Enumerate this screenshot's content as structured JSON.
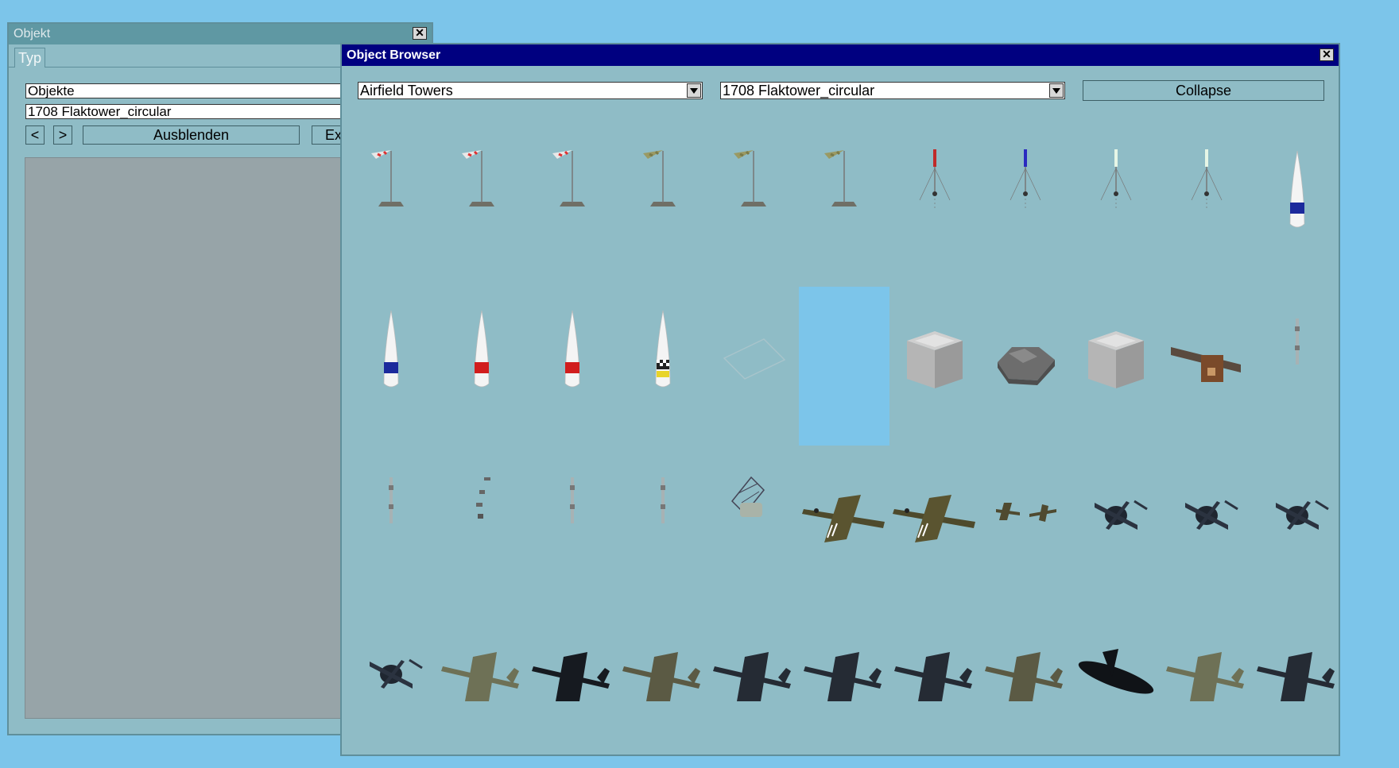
{
  "objekt_window": {
    "title": "Objekt",
    "tab": "Typ",
    "field_category": "Objekte",
    "field_object": "1708 Flaktower_circular",
    "prev_label": "<",
    "next_label": ">",
    "hide_label": "Ausblenden",
    "extra_label": "Ex"
  },
  "browser": {
    "title": "Object Browser",
    "category_select": "Airfield Towers",
    "object_select": "1708 Flaktower_circular",
    "collapse_label": "Collapse",
    "selected_index": 16
  },
  "thumbnails": [
    "windsock-red-icon",
    "windsock-red-icon",
    "windsock-red-icon",
    "windsock-olive-icon",
    "windsock-olive-icon",
    "windsock-olive-icon",
    "beacon-mast-red-icon",
    "beacon-mast-blue-icon",
    "beacon-mast-green-icon",
    "beacon-mast-green-icon",
    "air-race-pylon-blue-icon",
    "air-race-pylon-blue-icon",
    "air-race-pylon-red-icon",
    "air-race-pylon-red-icon",
    "air-race-pylon-checkered-icon",
    "faint-outline-icon",
    "empty-slot-icon",
    "flak-tower-square-icon",
    "flak-tower-circular-icon",
    "flak-tower-square-icon",
    "control-tower-wooden-icon",
    "tiny-mast-icon",
    "tiny-mast-icon",
    "scattered-debris-icon",
    "tiny-mast-icon",
    "tiny-mast-icon",
    "radar-dish-icon",
    "aircraft-invasion-stripes-icon",
    "aircraft-invasion-stripes-icon",
    "small-aircraft-pair-icon",
    "helicopter-icon",
    "helicopter-icon",
    "helicopter-icon",
    "helicopter-icon",
    "jet-fighter-camo-icon",
    "jet-fighter-dark-icon",
    "prop-fighter-camo-icon",
    "prop-fighter-dark-icon",
    "prop-fighter-dark-icon",
    "prop-fighter-dark-icon",
    "prop-fighter-camo-icon",
    "elliptical-wing-fighter-dark-icon",
    "jet-fighter-camo-icon",
    "prop-fighter-dark-icon"
  ]
}
